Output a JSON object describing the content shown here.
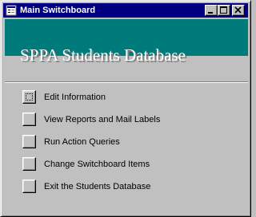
{
  "window": {
    "title": "Main Switchboard",
    "title_icon": "form-icon",
    "controls": [
      "minimize-icon",
      "maximize-icon",
      "close-icon"
    ]
  },
  "banner": {
    "title": "SPPA Students Database",
    "color": "#007b7b"
  },
  "menu": {
    "items": [
      {
        "label": "Edit Information",
        "focused": true
      },
      {
        "label": "View Reports and Mail Labels",
        "focused": false
      },
      {
        "label": "Run Action Queries",
        "focused": false
      },
      {
        "label": "Change Switchboard Items",
        "focused": false
      },
      {
        "label": "Exit the Students Database",
        "focused": false
      }
    ]
  },
  "colors": {
    "titlebar": "#000080",
    "face": "#c0c0c0"
  }
}
